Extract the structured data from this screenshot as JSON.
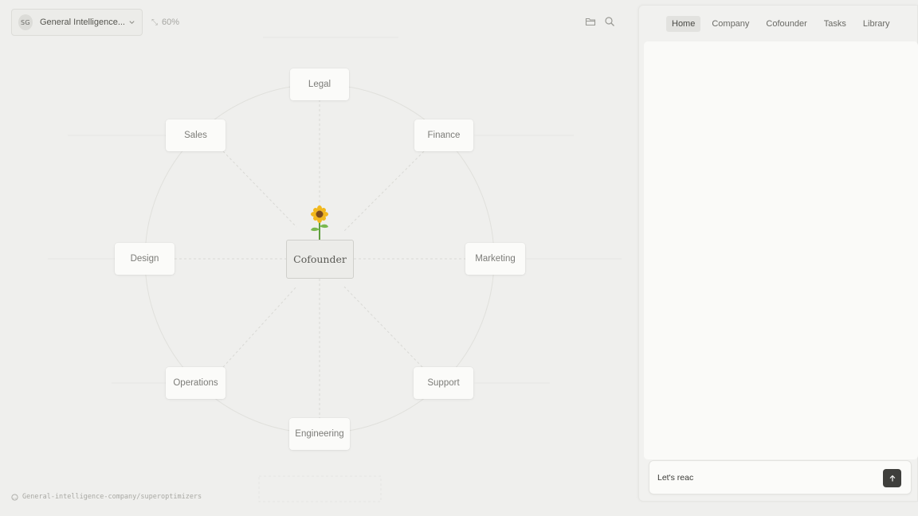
{
  "workspace": {
    "avatar_initials": "SG",
    "company_name": "General Intelligence...",
    "zoom_label": "60%"
  },
  "graph": {
    "center_label": "Cofounder",
    "departments": [
      {
        "label": "Legal"
      },
      {
        "label": "Finance"
      },
      {
        "label": "Marketing"
      },
      {
        "label": "Support"
      },
      {
        "label": "Engineering"
      },
      {
        "label": "Operations"
      },
      {
        "label": "Design"
      },
      {
        "label": "Sales"
      }
    ]
  },
  "repo": {
    "path": "General-intelligence-company/superoptimizers"
  },
  "panel": {
    "tabs": [
      {
        "label": "Home",
        "active": true
      },
      {
        "label": "Company",
        "active": false
      },
      {
        "label": "Cofounder",
        "active": false
      },
      {
        "label": "Tasks",
        "active": false
      },
      {
        "label": "Library",
        "active": false
      }
    ],
    "chat_input_value": "Let's reac"
  },
  "icons": {
    "company_chevron": "chevron-down-icon",
    "zoom": "zoom-icon",
    "folder": "folder-icon",
    "search": "search-icon",
    "repo": "github-icon",
    "send": "arrow-up-icon",
    "mascot": "sunflower-icon"
  },
  "colors": {
    "background": "#efefed",
    "panel": "#fafaf8",
    "send_button": "#3f3f3c"
  }
}
